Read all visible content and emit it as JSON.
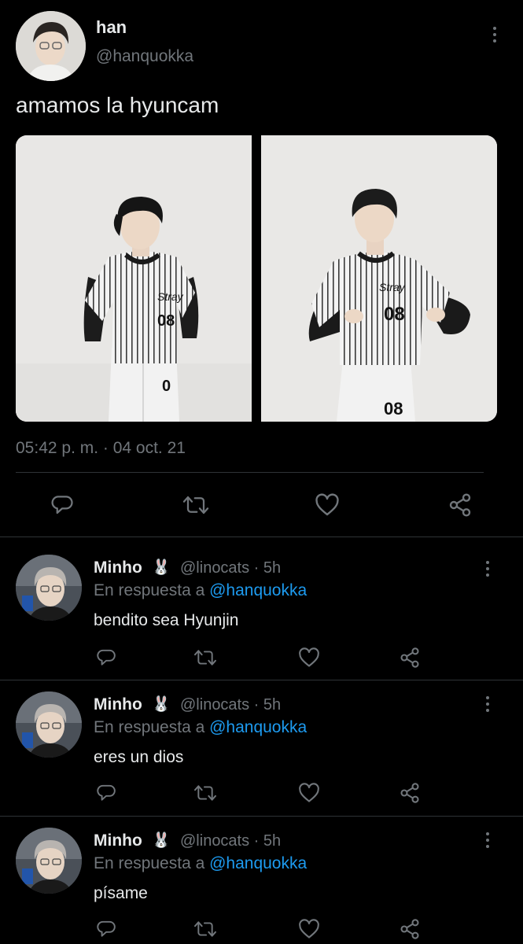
{
  "main_tweet": {
    "display_name": "han",
    "handle": "@hanquokka",
    "text": "amamos la hyuncam",
    "timestamp": "05:42 p. m. · 04 oct. 21",
    "avatar_icon": "avatar-photo",
    "media": [
      {
        "jersey_number": "08",
        "description_icon": "photo"
      },
      {
        "jersey_number": "08",
        "description_icon": "photo"
      }
    ]
  },
  "actions": {
    "reply_icon": "comment-icon",
    "retweet_icon": "retweet-icon",
    "like_icon": "heart-icon",
    "share_icon": "share-icon"
  },
  "replies": [
    {
      "display_name": "Minho",
      "emoji": "🐰",
      "handle": "@linocats · 5h",
      "context_prefix": "En respuesta a ",
      "mention": "@hanquokka",
      "text": "bendito sea Hyunjin"
    },
    {
      "display_name": "Minho",
      "emoji": "🐰",
      "handle": "@linocats · 5h",
      "context_prefix": "En respuesta a ",
      "mention": "@hanquokka",
      "text": "eres un dios"
    },
    {
      "display_name": "Minho",
      "emoji": "🐰",
      "handle": "@linocats · 5h",
      "context_prefix": "En respuesta a ",
      "mention": "@hanquokka",
      "text": "písame"
    }
  ],
  "colors": {
    "background": "#000000",
    "text_primary": "#e7e9ea",
    "text_secondary": "#71767b",
    "link": "#1d9bf0",
    "divider": "#2f3336"
  }
}
